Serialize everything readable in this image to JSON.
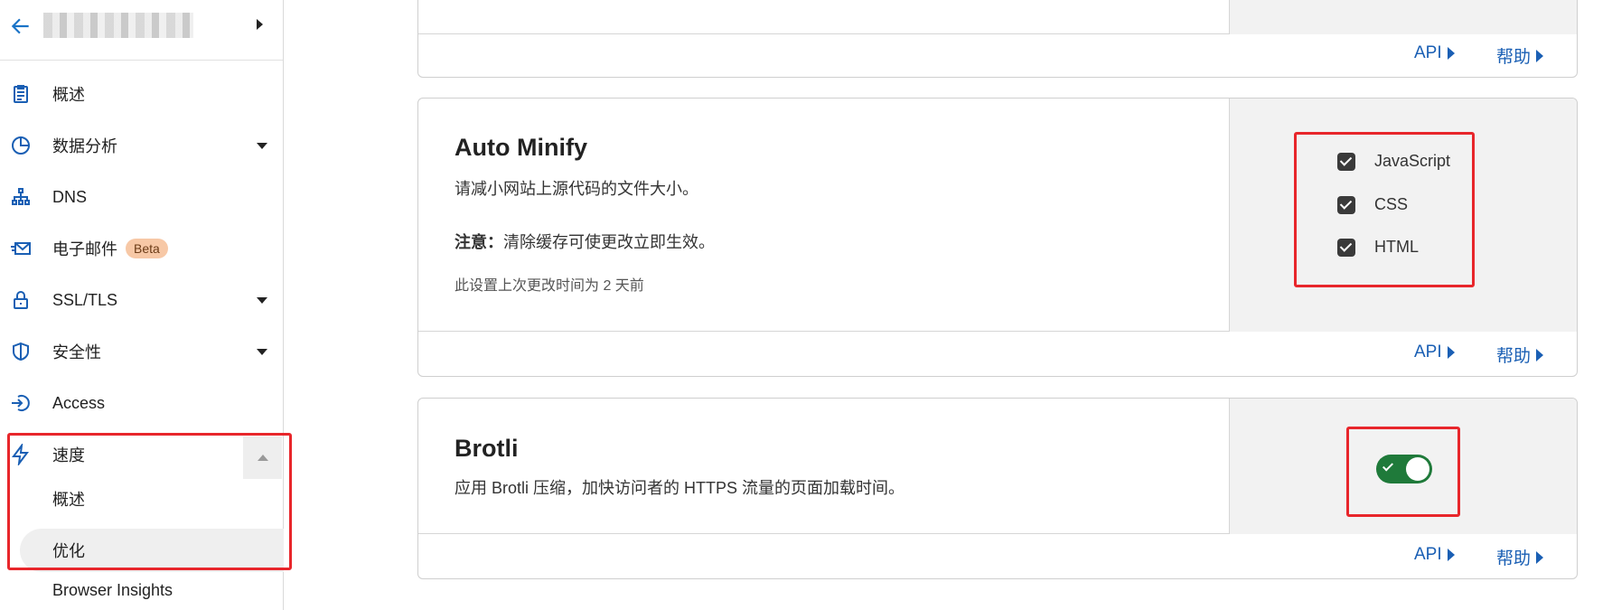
{
  "sidebar": {
    "items": [
      {
        "label": "概述",
        "icon": "clipboard-icon"
      },
      {
        "label": "数据分析",
        "icon": "pie-chart-icon"
      },
      {
        "label": "DNS",
        "icon": "network-icon"
      },
      {
        "label": "电子邮件",
        "icon": "email-icon",
        "badge": "Beta"
      },
      {
        "label": "SSL/TLS",
        "icon": "lock-icon"
      },
      {
        "label": "安全性",
        "icon": "shield-icon"
      },
      {
        "label": "Access",
        "icon": "access-icon"
      },
      {
        "label": "速度",
        "icon": "lightning-icon"
      }
    ],
    "sub_items": [
      {
        "label": "概述"
      },
      {
        "label": "优化"
      },
      {
        "label": "Browser Insights"
      }
    ]
  },
  "cards": {
    "top": {
      "api_label": "API",
      "help_label": "帮助"
    },
    "auto_minify": {
      "title": "Auto Minify",
      "description": "请减小网站上源代码的文件大小。",
      "note_label": "注意：",
      "note_text": "清除缓存可使更改立即生效。",
      "meta": "此设置上次更改时间为 2 天前",
      "options": [
        {
          "label": "JavaScript",
          "checked": true
        },
        {
          "label": "CSS",
          "checked": true
        },
        {
          "label": "HTML",
          "checked": true
        }
      ],
      "api_label": "API",
      "help_label": "帮助"
    },
    "brotli": {
      "title": "Brotli",
      "description": "应用 Brotli 压缩，加快访问者的 HTTPS 流量的页面加载时间。",
      "enabled": true,
      "api_label": "API",
      "help_label": "帮助"
    }
  },
  "colors": {
    "accent": "#1a5fb4",
    "toggle_on": "#1f7a3a",
    "highlight": "#e8262b"
  }
}
